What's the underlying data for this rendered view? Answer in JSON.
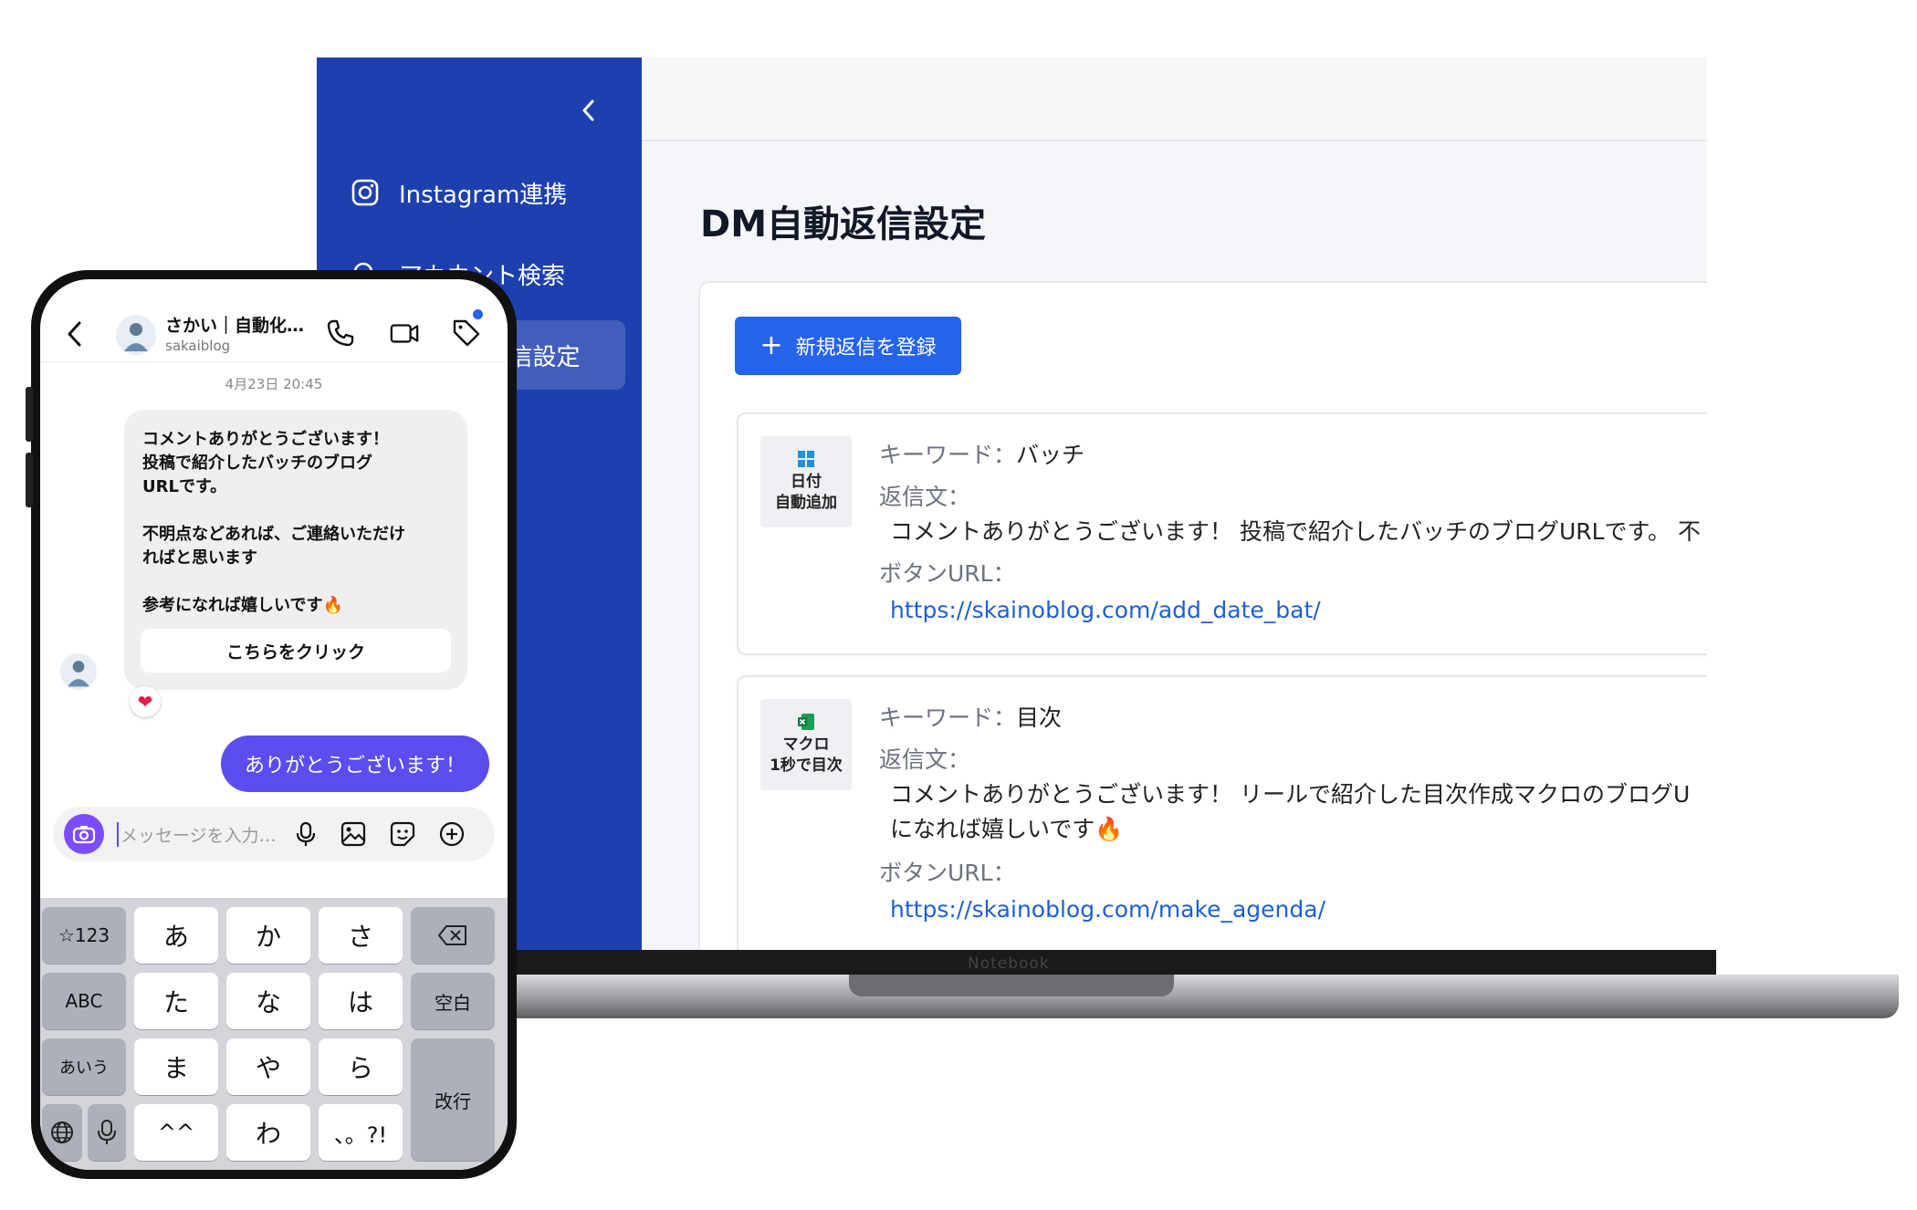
{
  "laptop": {
    "brand": "Notebook",
    "sidebar": {
      "items": [
        {
          "label": "Instagram連携"
        },
        {
          "label": "アカウント検索"
        },
        {
          "label": "DM自動返信設定"
        }
      ]
    },
    "page_title": "DM自動返信設定",
    "new_button_label": "新規返信を登録",
    "rules": [
      {
        "thumb_line1": "日付",
        "thumb_line2": "自動追加",
        "keyword_label": "キーワード：",
        "keyword": "バッチ",
        "reply_label": "返信文：",
        "reply_line1": "コメントありがとうございます！ 投稿で紹介したバッチのブログURLです。 不",
        "reply_line2": "",
        "url_label": "ボタンURL：",
        "url": "https://skainoblog.com/add_date_bat/"
      },
      {
        "thumb_line1": "マクロ",
        "thumb_line2": "1秒で目次",
        "keyword_label": "キーワード：",
        "keyword": "目次",
        "reply_label": "返信文：",
        "reply_line1": "コメントありがとうございます！ リールで紹介した目次作成マクロのブログU",
        "reply_line2": "になれば嬉しいです🔥",
        "url_label": "ボタンURL：",
        "url": "https://skainoblog.com/make_agenda/"
      }
    ]
  },
  "phone": {
    "chat_name": "さかい｜自動化…",
    "chat_handle": "sakaiblog",
    "timestamp": "4月23日 20:45",
    "bubble_lines": [
      "コメントありがとうございます！",
      "投稿で紹介したバッチのブログ",
      "URLです。",
      "",
      "不明点などあれば、ご連絡いただけ",
      "ればと思います",
      "",
      "参考になれば嬉しいです🔥"
    ],
    "cta_label": "こちらをクリック",
    "reaction": "❤",
    "my_message": "ありがとうございます！",
    "compose_placeholder": "メッセージを入力…",
    "keyboard": {
      "row1": [
        "☆123",
        "あ",
        "か",
        "さ"
      ],
      "row2": [
        "ABC",
        "た",
        "な",
        "は",
        "空白"
      ],
      "row3": [
        "あいう",
        "ま",
        "や",
        "ら",
        "改行"
      ],
      "row4": [
        "^^",
        "わ",
        "、。?!"
      ]
    }
  },
  "colors": {
    "sidebar": "#1e40af",
    "primary_button": "#2563eb",
    "link": "#1d5fd6",
    "my_bubble": "#5b4df0"
  }
}
